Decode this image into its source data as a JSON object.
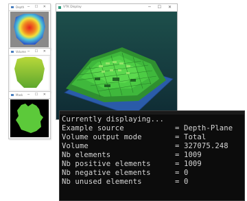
{
  "preview_windows": [
    {
      "title": "Depth",
      "image": "depth-heatmap"
    },
    {
      "title": "Volume",
      "image": "volume-shade"
    },
    {
      "title": "Mask",
      "image": "green-mask"
    }
  ],
  "window_controls": "─ ☐ ✕",
  "viewer": {
    "title": "VTK Display"
  },
  "console": {
    "header": "Currently displaying...",
    "rows": [
      {
        "key": "Example source",
        "sep": "= ",
        "value": "Depth-Plane"
      },
      {
        "key": "Volume output mode",
        "sep": "= ",
        "value": "Total"
      },
      {
        "key": "Volume",
        "sep": "= ",
        "value": "327075.248"
      },
      {
        "key": "Nb elements",
        "sep": "= ",
        "value": "1009"
      },
      {
        "key": "Nb positive elements",
        "sep": "= ",
        "value": "1009"
      },
      {
        "key": "Nb negative elements",
        "sep": "= ",
        "value": "0"
      },
      {
        "key": "Nb unused elements",
        "sep": "= ",
        "value": "0"
      }
    ]
  },
  "colors": {
    "console_bg": "#0c0c0c",
    "console_text": "#d6d6d6",
    "voxel_green": "#3fb83c",
    "plane_blue": "#2c5fb3"
  }
}
